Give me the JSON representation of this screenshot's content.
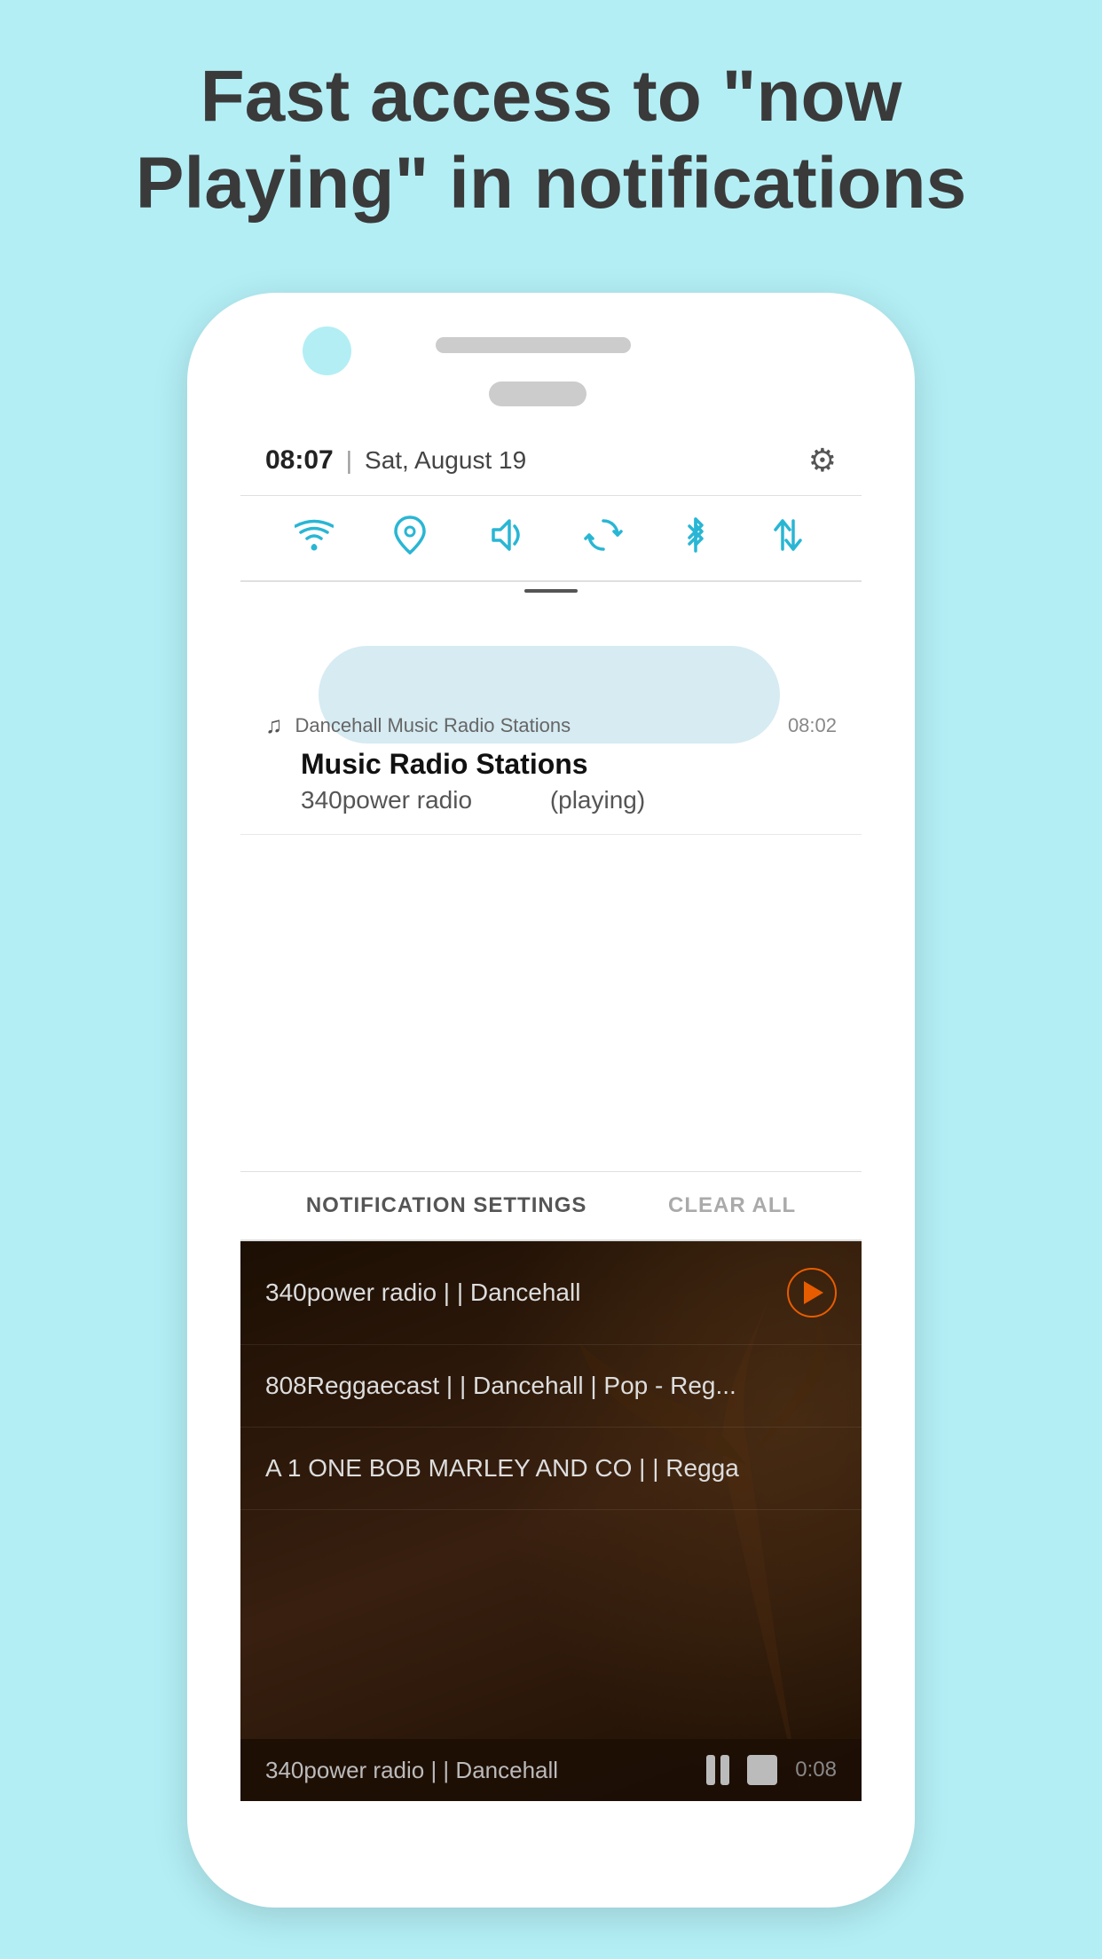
{
  "page": {
    "bg_color": "#b3eef5",
    "header": {
      "line1": "Fast access to \"now",
      "line2": "Playing\" in notifications"
    }
  },
  "status_bar": {
    "time": "08:07",
    "divider": "|",
    "date": "Sat, August 19",
    "gear_icon": "⚙"
  },
  "quick_settings": {
    "icons": [
      "wifi",
      "location",
      "volume",
      "sync",
      "bluetooth",
      "transfer"
    ]
  },
  "notification": {
    "app_icon": "♫",
    "app_name": "Dancehall Music Radio Stations",
    "time": "08:02",
    "title": "Music Radio Stations",
    "subtitle_left": "340power radio",
    "subtitle_right": "(playing)"
  },
  "notif_footer": {
    "settings_label": "NOTIFICATION SETTINGS",
    "clear_label": "CLEAR ALL"
  },
  "radio_list": [
    {
      "name": "340power radio | | Dancehall",
      "has_play": true
    },
    {
      "name": "808Reggaecast | | Dancehall | Pop - Reg...",
      "has_play": false
    },
    {
      "name": "A 1 ONE BOB MARLEY AND CO | | Regga",
      "has_play": false
    }
  ],
  "bottom_bar": {
    "station": "340power radio | | Dancehall",
    "timer": "0:08"
  }
}
